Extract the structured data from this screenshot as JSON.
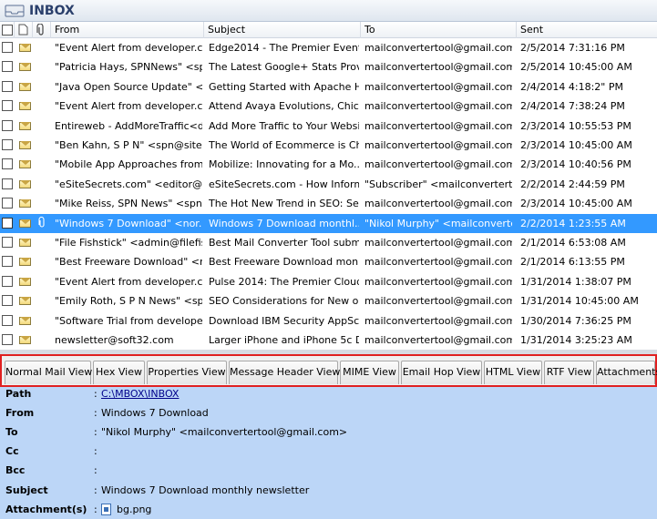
{
  "window": {
    "title": "INBOX"
  },
  "columns": {
    "from": "From",
    "subject": "Subject",
    "to": "To",
    "sent": "Sent"
  },
  "emails": [
    {
      "from": "\"Event Alert from developer.co...",
      "subject": "Edge2014 - The Premier Event f...",
      "to": "mailconvertertool@gmail.com",
      "sent": "2/5/2014 7:31:16 PM",
      "attachment": false,
      "selected": false
    },
    {
      "from": "\"Patricia Hays, SPNNews\" <spn...",
      "subject": "The Latest Google+ Stats Prov...",
      "to": "mailconvertertool@gmail.com",
      "sent": "2/5/2014 10:45:00 AM",
      "attachment": false,
      "selected": false
    },
    {
      "from": "\"Java Open Source Update\" <...",
      "subject": "Getting Started with Apache H...",
      "to": "mailconvertertool@gmail.com",
      "sent": "2/4/2014 4:18:2\" PM",
      "attachment": false,
      "selected": false
    },
    {
      "from": "\"Event Alert from developer.co...",
      "subject": "Attend Avaya Evolutions, Chica...",
      "to": "mailconvertertool@gmail.com",
      "sent": "2/4/2014 7:38:24 PM",
      "attachment": false,
      "selected": false
    },
    {
      "from": "Entireweb - AddMoreTraffic<d...",
      "subject": "Add More Traffic to Your Websi...",
      "to": "mailconvertertool@gmail.com",
      "sent": "2/3/2014 10:55:53 PM",
      "attachment": false,
      "selected": false
    },
    {
      "from": "\"Ben Kahn, S P N\" <spn@sitep...",
      "subject": "The World of Ecommerce is Ch...",
      "to": "mailconvertertool@gmail.com",
      "sent": "2/3/2014 10:45:00 AM",
      "attachment": false,
      "selected": false
    },
    {
      "from": "\"Mobile App Approaches from...",
      "subject": "Mobilize: Innovating for a Mo...",
      "to": "mailconvertertool@gmail.com",
      "sent": "2/3/2014 10:40:56 PM",
      "attachment": false,
      "selected": false
    },
    {
      "from": "\"eSiteSecrets.com\" <editor@es...",
      "subject": "eSiteSecrets.com - How Inform...",
      "to": "\"Subscriber\" <mailconvertertoo...",
      "sent": "2/2/2014 2:44:59 PM",
      "attachment": false,
      "selected": false
    },
    {
      "from": "\"Mike Reiss, SPN News\" <spn...",
      "subject": "The Hot New Trend in SEO: Se...",
      "to": "mailconvertertool@gmail.com",
      "sent": "2/3/2014 10:45:00 AM",
      "attachment": false,
      "selected": false
    },
    {
      "from": "\"Windows 7 Download\" <nor...",
      "subject": "Windows 7 Download monthl...",
      "to": "\"Nikol Murphy\" <mailconverter...",
      "sent": "2/2/2014 1:23:55 AM",
      "attachment": true,
      "selected": true
    },
    {
      "from": "\"File Fishstick\" <admin@filefis...",
      "subject": "Best Mail Converter Tool submi...",
      "to": "mailconvertertool@gmail.com",
      "sent": "2/1/2014 6:53:08 AM",
      "attachment": false,
      "selected": false
    },
    {
      "from": "\"Best Freeware Download\" <n...",
      "subject": "Best Freeware Download mon...",
      "to": "mailconvertertool@gmail.com",
      "sent": "2/1/2014 6:13:55 PM",
      "attachment": false,
      "selected": false
    },
    {
      "from": "\"Event Alert from developer.co...",
      "subject": "Pulse 2014: The Premier Cloud ...",
      "to": "mailconvertertool@gmail.com",
      "sent": "1/31/2014 1:38:07 PM",
      "attachment": false,
      "selected": false
    },
    {
      "from": "\"Emily Roth, S P N News\" <spn...",
      "subject": "SEO Considerations for New o...",
      "to": "mailconvertertool@gmail.com",
      "sent": "1/31/2014 10:45:00 AM",
      "attachment": false,
      "selected": false
    },
    {
      "from": "\"Software Trial from developer...",
      "subject": "Download IBM Security AppSc...",
      "to": "mailconvertertool@gmail.com",
      "sent": "1/30/2014 7:36:25 PM",
      "attachment": false,
      "selected": false
    },
    {
      "from": "newsletter@soft32.com",
      "subject": "Larger iPhone and iPhone 5c D...",
      "to": "mailconvertertool@gmail.com",
      "sent": "1/31/2014 3:25:23 AM",
      "attachment": false,
      "selected": false
    }
  ],
  "tabs": [
    "Normal Mail View",
    "Hex View",
    "Properties View",
    "Message Header View",
    "MIME View",
    "Email Hop View",
    "HTML View",
    "RTF View",
    "Attachments"
  ],
  "details": {
    "path_label": "Path",
    "path_value": "C:\\MBOX\\INBOX",
    "from_label": "From",
    "from_value": "Windows 7 Download",
    "to_label": "To",
    "to_value": "\"Nikol Murphy\" <mailconvertertool@gmail.com>",
    "cc_label": "Cc",
    "cc_value": "",
    "bcc_label": "Bcc",
    "bcc_value": "",
    "subject_label": "Subject",
    "subject_value": "Windows 7 Download monthly newsletter",
    "attachments_label": "Attachment(s)",
    "attachments_value": "bg.png",
    "colon": ":"
  },
  "colors": {
    "selection": "#3399ff",
    "details_bg": "#bcd6f7",
    "tab_highlight": "#e02020"
  }
}
